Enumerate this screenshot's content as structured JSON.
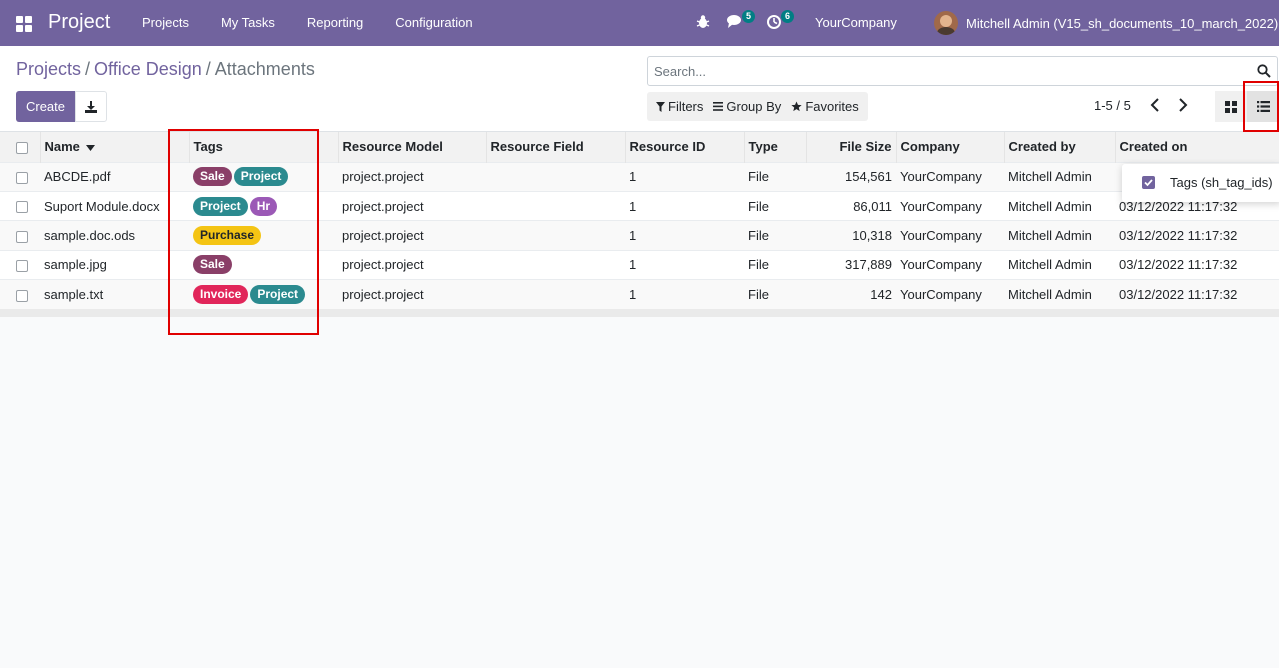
{
  "navbar": {
    "app_title": "Project",
    "menu": [
      "Projects",
      "My Tasks",
      "Reporting",
      "Configuration"
    ],
    "messages_count": "5",
    "activities_count": "6",
    "company": "YourCompany",
    "user": "Mitchell Admin (V15_sh_documents_10_march_2022)"
  },
  "breadcrumb": {
    "item1": "Projects",
    "sep1": "/",
    "item2": "Office Design",
    "sep2": "/",
    "current": "Attachments"
  },
  "toolbar": {
    "create_label": "Create"
  },
  "search": {
    "placeholder": "Search...",
    "filters_label": "Filters",
    "groupby_label": "Group By",
    "favorites_label": "Favorites"
  },
  "pager": {
    "text": "1-5 / 5"
  },
  "table": {
    "headers": {
      "name": "Name",
      "tags": "Tags",
      "resource_model": "Resource Model",
      "resource_field": "Resource Field",
      "resource_id": "Resource ID",
      "type": "Type",
      "file_size": "File Size",
      "company": "Company",
      "created_by": "Created by",
      "created_on": "Created on"
    },
    "rows": [
      {
        "name": "ABCDE.pdf",
        "tags": [
          {
            "label": "Sale",
            "color": "#8a3f68"
          },
          {
            "label": "Project",
            "color": "#2b8a8f"
          }
        ],
        "resource_model": "project.project",
        "resource_field": "",
        "resource_id": "1",
        "type": "File",
        "file_size": "154,561",
        "company": "YourCompany",
        "created_by": "Mitchell Admin",
        "created_on": ""
      },
      {
        "name": "Suport Module.docx",
        "tags": [
          {
            "label": "Project",
            "color": "#2b8a8f"
          },
          {
            "label": "Hr",
            "color": "#9b59b6"
          }
        ],
        "resource_model": "project.project",
        "resource_field": "",
        "resource_id": "1",
        "type": "File",
        "file_size": "86,011",
        "company": "YourCompany",
        "created_by": "Mitchell Admin",
        "created_on": "03/12/2022 11:17:32"
      },
      {
        "name": "sample.doc.ods",
        "tags": [
          {
            "label": "Purchase",
            "color": "#f4c414"
          }
        ],
        "resource_model": "project.project",
        "resource_field": "",
        "resource_id": "1",
        "type": "File",
        "file_size": "10,318",
        "company": "YourCompany",
        "created_by": "Mitchell Admin",
        "created_on": "03/12/2022 11:17:32"
      },
      {
        "name": "sample.jpg",
        "tags": [
          {
            "label": "Sale",
            "color": "#8a3f68"
          }
        ],
        "resource_model": "project.project",
        "resource_field": "",
        "resource_id": "1",
        "type": "File",
        "file_size": "317,889",
        "company": "YourCompany",
        "created_by": "Mitchell Admin",
        "created_on": "03/12/2022 11:17:32"
      },
      {
        "name": "sample.txt",
        "tags": [
          {
            "label": "Invoice",
            "color": "#e1265a"
          },
          {
            "label": "Project",
            "color": "#2b8a8f"
          }
        ],
        "resource_model": "project.project",
        "resource_field": "",
        "resource_id": "1",
        "type": "File",
        "file_size": "142",
        "company": "YourCompany",
        "created_by": "Mitchell Admin",
        "created_on": "03/12/2022 11:17:32"
      }
    ]
  },
  "optional_columns": {
    "item_label": "Tags (sh_tag_ids)"
  },
  "colors": {
    "brand": "#71639e",
    "highlight_border": "#e00000"
  }
}
